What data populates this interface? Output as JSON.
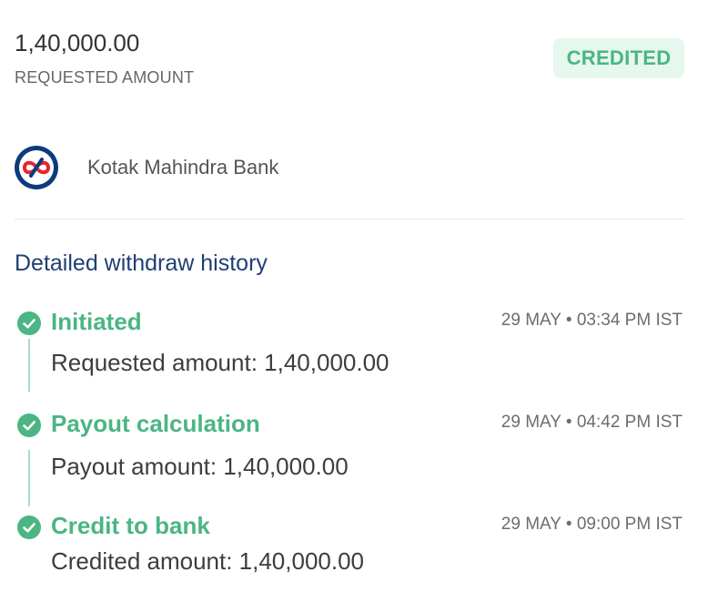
{
  "summary": {
    "amount": "1,40,000.00",
    "amount_label": "REQUESTED AMOUNT",
    "status": "CREDITED"
  },
  "bank": {
    "name": "Kotak Mahindra Bank",
    "logo_icon": "kotak-logo-icon"
  },
  "history": {
    "title": "Detailed withdraw history",
    "steps": [
      {
        "title": "Initiated",
        "time": "29 MAY • 03:34 PM IST",
        "detail": "Requested amount: 1,40,000.00"
      },
      {
        "title": "Payout calculation",
        "time": "29 MAY • 04:42 PM IST",
        "detail": "Payout amount: 1,40,000.00"
      },
      {
        "title": "Credit to bank",
        "time": "29 MAY • 09:00 PM IST",
        "detail": "Credited amount: 1,40,000.00"
      }
    ]
  },
  "colors": {
    "accent_green": "#4bb584",
    "badge_bg": "#e6f7ee",
    "title_blue": "#1f3f73",
    "logo_navy": "#0c3b7c",
    "logo_red": "#e6252d"
  }
}
